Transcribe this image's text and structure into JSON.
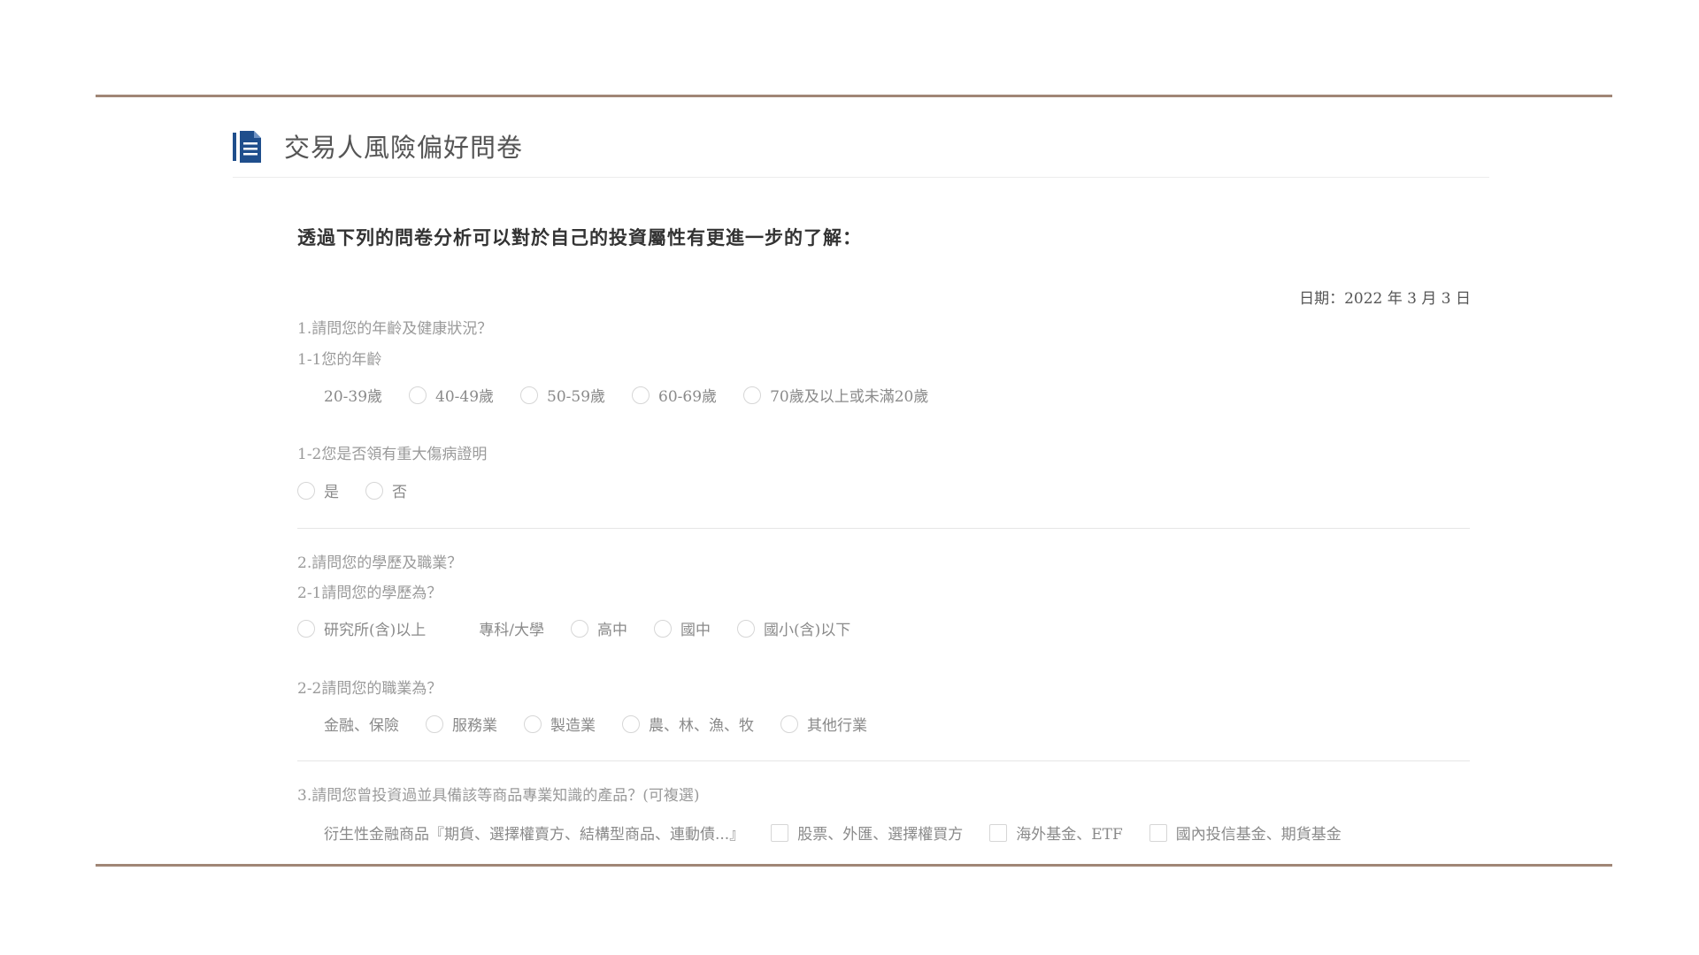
{
  "header": {
    "icon": "document-list-icon",
    "title": "交易人風險偏好問卷"
  },
  "intro": "透過下列的問卷分析可以對於自己的投資屬性有更進一步的了解：",
  "date": "日期：2022 年 3 月 3 日",
  "colors": {
    "frame_line": "#a08676",
    "icon_blue": "#1f4e8c"
  },
  "q1": {
    "title": "1.請問您的年齡及健康狀況？",
    "q1_1": {
      "label": "1-1您的年齡",
      "options": [
        "20-39歲",
        "40-49歲",
        "50-59歲",
        "60-69歲",
        "70歲及以上或未滿20歲"
      ]
    },
    "q1_2": {
      "label": "1-2您是否領有重大傷病證明",
      "options": [
        "是",
        "否"
      ]
    }
  },
  "q2": {
    "title": "2.請問您的學歷及職業？",
    "q2_1": {
      "label": "2-1請問您的學歷為？",
      "options": [
        "研究所(含)以上",
        "專科/大學",
        "高中",
        "國中",
        "國小(含)以下"
      ]
    },
    "q2_2": {
      "label": "2-2請問您的職業為？",
      "options": [
        "金融、保險",
        "服務業",
        "製造業",
        "農、林、漁、牧",
        "其他行業"
      ]
    }
  },
  "q3": {
    "title": "3.請問您曾投資過並具備該等商品專業知識的產品？(可複選)",
    "options": [
      "衍生性金融商品『期貨、選擇權賣方、結構型商品、連動債...』",
      "股票、外匯、選擇權買方",
      "海外基金、ETF",
      "國內投信基金、期貨基金"
    ]
  }
}
